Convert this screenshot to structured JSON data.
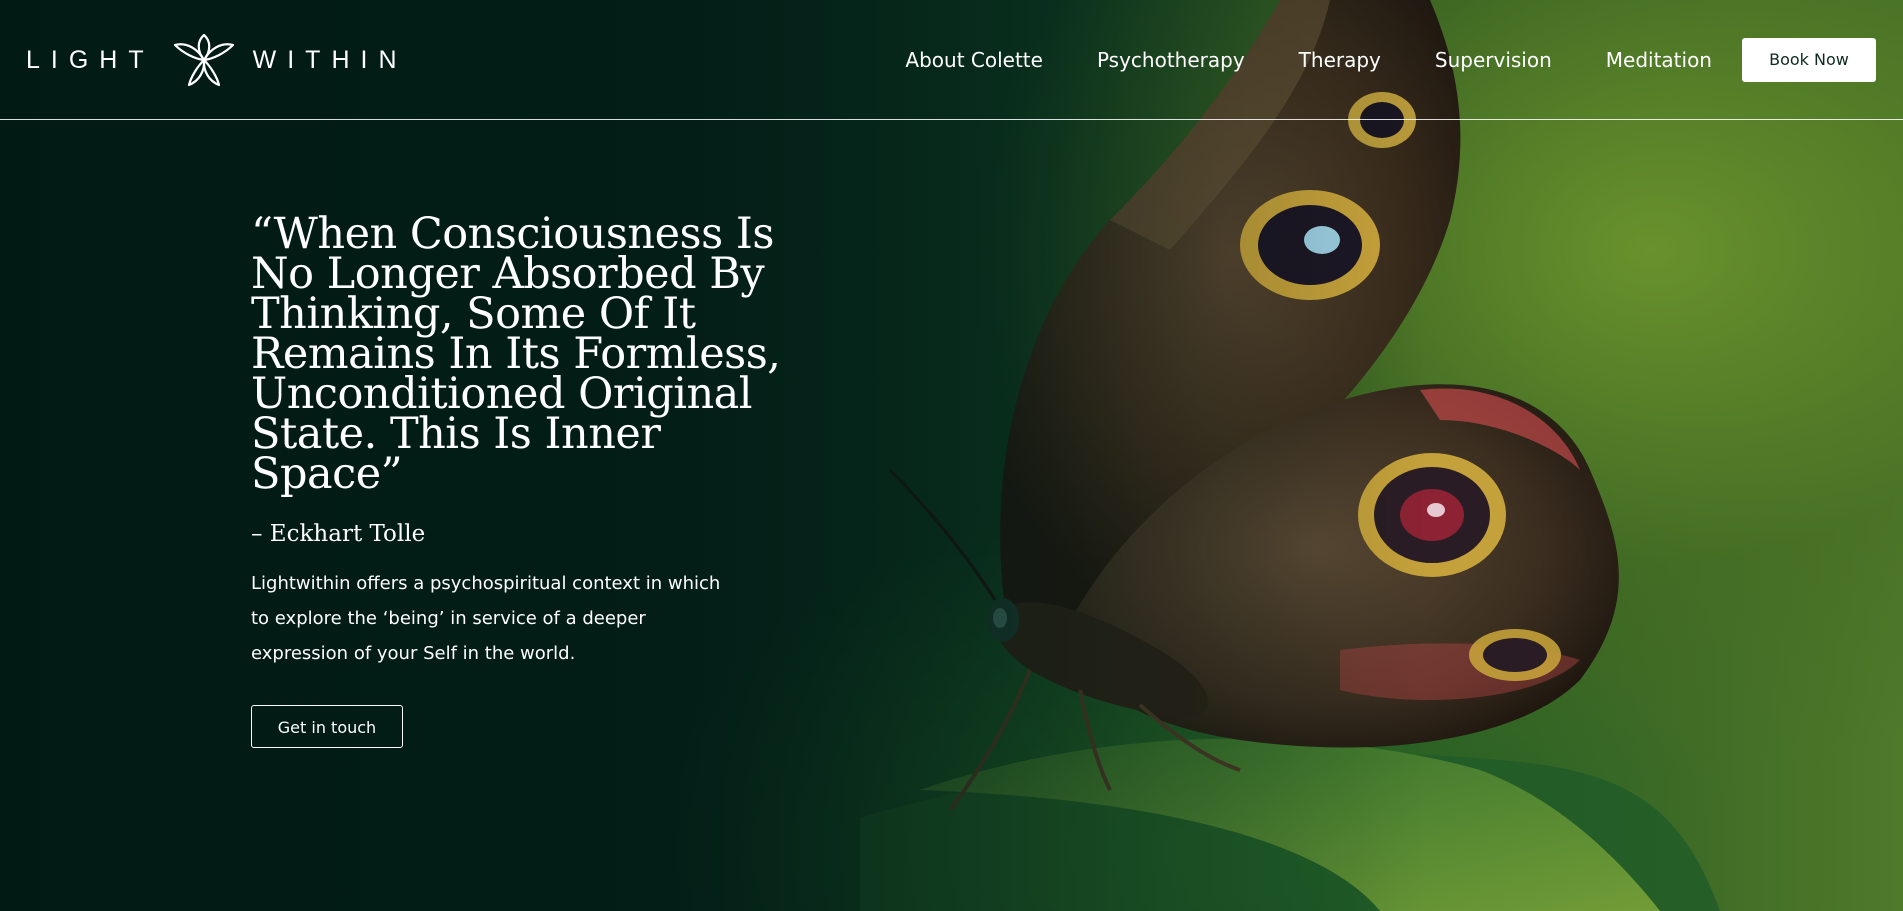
{
  "brand": {
    "word_left": "LIGHT",
    "word_right": "WITHIN",
    "logo_icon": "lotus-flower-icon"
  },
  "nav": {
    "items": [
      {
        "label": "About Colette"
      },
      {
        "label": "Psychotherapy"
      },
      {
        "label": "Therapy"
      },
      {
        "label": "Supervision"
      },
      {
        "label": "Meditation"
      }
    ],
    "cta_label": "Book Now"
  },
  "hero": {
    "quote": "“When Consciousness Is No Longer Absorbed By Thinking, Some Of It Remains In Its Formless, Unconditioned Original State. This Is Inner Space”",
    "author": "– Eckhart Tolle",
    "description": "Lightwithin offers a psychospiritual context in which to explore the ‘being’ in service of a deeper expression of your Self in the world.",
    "cta_label": "Get in touch",
    "background_image": "butterfly-on-leaf"
  },
  "colors": {
    "background_dark": "#062019",
    "accent_green": "#4f7a2a",
    "text": "#ffffff",
    "button_text": "#0e2a22"
  }
}
